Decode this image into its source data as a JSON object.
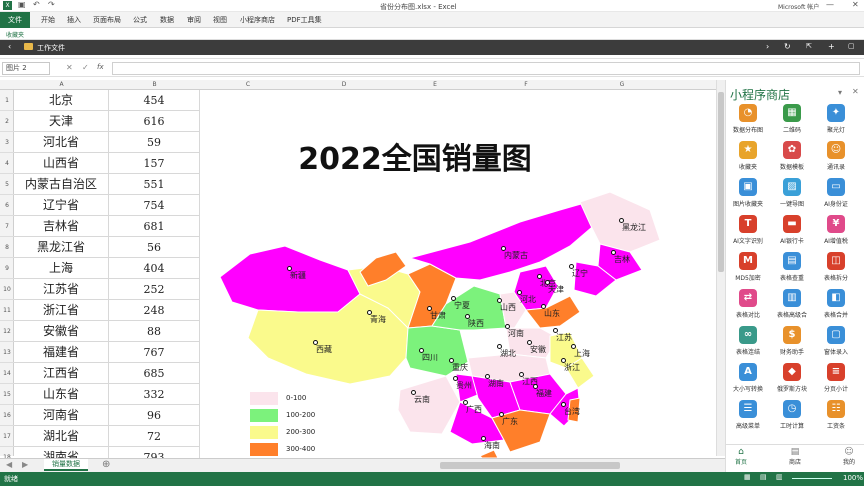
{
  "window": {
    "title": "省份分布图.xlsx - Excel",
    "account": "Microsoft 帐户"
  },
  "ribbon": {
    "file": "文件",
    "tabs": [
      "开始",
      "插入",
      "页面布局",
      "公式",
      "数据",
      "审阅",
      "视图",
      "小程序商店",
      "PDF工具集"
    ]
  },
  "favorites": {
    "label": "收藏夹"
  },
  "workbar": {
    "label": "工作文件"
  },
  "formula": {
    "namebox": "图片 2",
    "fx": "fx",
    "value": ""
  },
  "columns": [
    "A",
    "B",
    "C",
    "D",
    "E",
    "F",
    "G"
  ],
  "rows": [
    {
      "n": "1",
      "province": "北京",
      "value": "454"
    },
    {
      "n": "2",
      "province": "天津",
      "value": "616"
    },
    {
      "n": "3",
      "province": "河北省",
      "value": "59"
    },
    {
      "n": "4",
      "province": "山西省",
      "value": "157"
    },
    {
      "n": "5",
      "province": "内蒙古自治区",
      "value": "551"
    },
    {
      "n": "6",
      "province": "辽宁省",
      "value": "754"
    },
    {
      "n": "7",
      "province": "吉林省",
      "value": "681"
    },
    {
      "n": "8",
      "province": "黑龙江省",
      "value": "56"
    },
    {
      "n": "9",
      "province": "上海",
      "value": "404"
    },
    {
      "n": "10",
      "province": "江苏省",
      "value": "252"
    },
    {
      "n": "11",
      "province": "浙江省",
      "value": "248"
    },
    {
      "n": "12",
      "province": "安徽省",
      "value": "88"
    },
    {
      "n": "13",
      "province": "福建省",
      "value": "767"
    },
    {
      "n": "14",
      "province": "江西省",
      "value": "685"
    },
    {
      "n": "15",
      "province": "山东省",
      "value": "332"
    },
    {
      "n": "16",
      "province": "河南省",
      "value": "96"
    },
    {
      "n": "17",
      "province": "湖北省",
      "value": "72"
    },
    {
      "n": "18",
      "province": "湖南省",
      "value": "793"
    }
  ],
  "chart": {
    "title": "2022全国销量图",
    "legend": [
      {
        "label": "0-100",
        "color": "#fbe4ec"
      },
      {
        "label": "100-200",
        "color": "#7cf27c"
      },
      {
        "label": "200-300",
        "color": "#fafa8c"
      },
      {
        "label": "300-400",
        "color": "#ff7f2a"
      }
    ],
    "map_labels": [
      "黑龙江",
      "吉林",
      "辽宁",
      "内蒙古",
      "北京",
      "天津",
      "河北",
      "山西",
      "山东",
      "宁夏",
      "甘肃",
      "陕西",
      "河南",
      "江苏",
      "安徽",
      "上海",
      "浙江",
      "湖北",
      "四川",
      "重庆",
      "湖南",
      "江西",
      "贵州",
      "福建",
      "云南",
      "广西",
      "广东",
      "台湾",
      "海南",
      "新疆",
      "青海",
      "西藏"
    ]
  },
  "sheet": {
    "active_tab": "销量数据"
  },
  "status": {
    "left": "就绪",
    "zoom": "100%"
  },
  "panel": {
    "title": "小程序商店",
    "items": [
      {
        "label": "数据分布图",
        "icon": "pie-icon",
        "color": "#e8912b"
      },
      {
        "label": "二维码",
        "icon": "qrcode-icon",
        "color": "#3a9a4a"
      },
      {
        "label": "聚光灯",
        "icon": "bulb-icon",
        "color": "#3a8fd8"
      },
      {
        "label": "收藏夹",
        "icon": "star-icon",
        "color": "#e8a42b"
      },
      {
        "label": "数据模板",
        "icon": "template-icon",
        "color": "#d84a4a"
      },
      {
        "label": "通讯录",
        "icon": "contacts-icon",
        "color": "#e8912b"
      },
      {
        "label": "图片收藏夹",
        "icon": "image-icon",
        "color": "#3a8fd8"
      },
      {
        "label": "一键导图",
        "icon": "picture-icon",
        "color": "#3aa0d8"
      },
      {
        "label": "AI身份证",
        "icon": "idcard-icon",
        "color": "#3a8fd8"
      },
      {
        "label": "AI文字识别",
        "icon": "text-icon",
        "color": "#d8402b"
      },
      {
        "label": "AI银行卡",
        "icon": "card-icon",
        "color": "#d8402b"
      },
      {
        "label": "AI增值税",
        "icon": "invoice-icon",
        "color": "#e04a8a"
      },
      {
        "label": "MD5加密",
        "icon": "md5-icon",
        "color": "#d8402b"
      },
      {
        "label": "表格查重",
        "icon": "search-table-icon",
        "color": "#3a8fd8"
      },
      {
        "label": "表格拆分",
        "icon": "split-icon",
        "color": "#d8402b"
      },
      {
        "label": "表格对比",
        "icon": "compare-icon",
        "color": "#e04a8a"
      },
      {
        "label": "表格高级合",
        "icon": "merge-icon",
        "color": "#3a8fd8"
      },
      {
        "label": "表格合并",
        "icon": "combine-icon",
        "color": "#3a8fd8"
      },
      {
        "label": "表格连结",
        "icon": "link-icon",
        "color": "#3a9a8a"
      },
      {
        "label": "财务助手",
        "icon": "finance-icon",
        "color": "#e8912b"
      },
      {
        "label": "窗体录入",
        "icon": "form-icon",
        "color": "#3a8fd8"
      },
      {
        "label": "大小写转换",
        "icon": "case-icon",
        "color": "#3a8fd8"
      },
      {
        "label": "俄罗斯方块",
        "icon": "cube-icon",
        "color": "#d8402b"
      },
      {
        "label": "分页小计",
        "icon": "subtotal-icon",
        "color": "#d8402b"
      },
      {
        "label": "高级菜单",
        "icon": "menu-icon",
        "color": "#3a8fd8"
      },
      {
        "label": "工时计算",
        "icon": "clock-icon",
        "color": "#3a8fd8"
      },
      {
        "label": "工资条",
        "icon": "salary-icon",
        "color": "#e8912b"
      }
    ],
    "nav": [
      {
        "label": "首页",
        "icon": "home-icon"
      },
      {
        "label": "商店",
        "icon": "store-icon"
      },
      {
        "label": "我的",
        "icon": "user-icon"
      }
    ]
  }
}
